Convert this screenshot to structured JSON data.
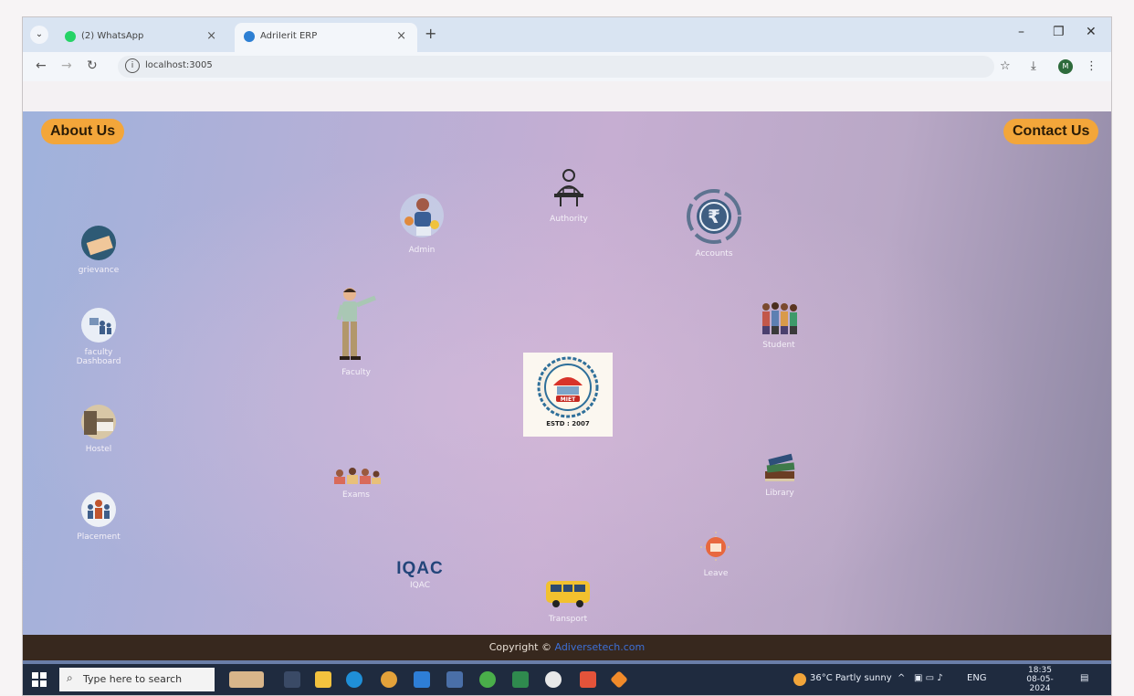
{
  "browser": {
    "tabs": [
      {
        "label": "(2) WhatsApp",
        "active": false,
        "favicon_color": "#25d366"
      },
      {
        "label": "AdriIerit ERP",
        "active": true,
        "favicon_color": "#2d7fd3"
      }
    ],
    "url": "localhost:3005",
    "profile_initial": "M"
  },
  "header": {
    "about_label": "About Us",
    "contact_label": "Contact Us"
  },
  "modules": {
    "grievance": "grievance",
    "faculty_dashboard_line1": "faculty",
    "faculty_dashboard_line2": "Dashboard",
    "hostel": "Hostel",
    "placement": "Placement",
    "admin": "Admin",
    "authority": "Authority",
    "accounts": "Accounts",
    "faculty": "Faculty",
    "student": "Student",
    "exams": "Exams",
    "library": "Library",
    "iqac_logo": "IQAC",
    "iqac": "IQAC",
    "leave": "Leave",
    "transport": "Transport"
  },
  "logo": {
    "name": "MIET",
    "estd": "ESTD : 2007"
  },
  "footer": {
    "prefix": "Copyright © ",
    "link": "Adiversetech.com"
  },
  "taskbar": {
    "search_placeholder": "Type here to search",
    "weather": "36°C  Partly sunny",
    "lang": "ENG",
    "time": "18:35",
    "date": "08-05-2024"
  },
  "colors": {
    "accent_button": "#f3a63a",
    "footer_bg": "#37281e",
    "taskbar_bg": "#1f2b3f"
  }
}
